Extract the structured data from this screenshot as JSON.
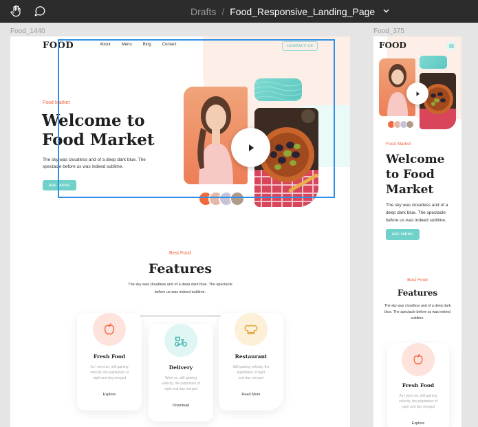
{
  "toolbar": {
    "hand_icon": "hand-icon",
    "comment_icon": "comment-icon",
    "breadcrumb": {
      "folder": "Drafts",
      "separator": "/",
      "file": "Food_Responsive_Landing_Page"
    }
  },
  "frames": {
    "desktop_label": "Food_1440",
    "mobile_label": "Food_375"
  },
  "desktop": {
    "logo": "FOOD",
    "nav": [
      "About",
      "Menu",
      "Blog",
      "Contact"
    ],
    "contact_button": "CONTACT US",
    "hero": {
      "tag": "Food Market",
      "title_line1": "Welcome to",
      "title_line2": "Food Market",
      "desc_line1": "The sky was cloudless and of a deep dark blue. The",
      "desc_line2": "spectacle before us was indeed sublime.",
      "button": "SEE MENU"
    },
    "features": {
      "tag": "Best Food",
      "title": "Features",
      "desc_line1": "The sky was cloudless and of a deep dark blue. The spectacle",
      "desc_line2": "before us was indeed sublime.",
      "cards": [
        {
          "title": "Fresh Food",
          "text_l1": "As I went on, still gaining",
          "text_l2": "velocity, the palpitation of",
          "text_l3": "night and day merged",
          "link": "Explore",
          "icon": "apple-icon"
        },
        {
          "title": "Delivery",
          "text_l1": "Went on, still gaining",
          "text_l2": "velocity, the palpitation of",
          "text_l3": "night and day merged",
          "link": "Download",
          "icon": "scooter-icon"
        },
        {
          "title": "Restaurant",
          "text_l1": "Still gaining velocity, the",
          "text_l2": "palpitation of night",
          "text_l3": "and day merged",
          "link": "Read More",
          "icon": "chef-hat-icon"
        }
      ]
    }
  },
  "mobile": {
    "logo": "FOOD",
    "hero": {
      "tag": "Food Market",
      "title_line1": "Welcome",
      "title_line2": "to Food",
      "title_line3": "Market",
      "desc_line1": "The sky was cloudless and of a",
      "desc_line2": "deep dark blue. The spectacle",
      "desc_line3": "before us was indeed sublime.",
      "button": "SEE MENU"
    },
    "features": {
      "tag": "Best Food",
      "title": "Features",
      "desc_line1": "The sky was cloudless and of a deep dark",
      "desc_line2": "blue. The spectacle before us was indeed",
      "desc_line3": "sublime.",
      "card": {
        "title": "Fresh Food",
        "text_l1": "As I went on, still gaining",
        "text_l2": "velocity, the palpitation of",
        "text_l3": "night and day merged",
        "link": "Explore"
      }
    }
  },
  "colors": {
    "accent_orange": "#f0613a",
    "mint": "#6fd1c9",
    "selection_blue": "#2f8fe6"
  }
}
